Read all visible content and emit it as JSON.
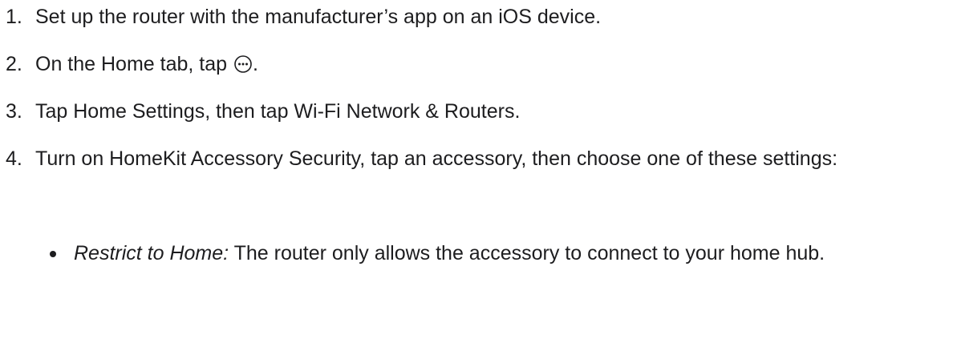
{
  "steps": [
    {
      "number": "1.",
      "text": "Set up the router with the manufacturer’s app on an iOS device."
    },
    {
      "number": "2.",
      "text_before": "On the Home tab, tap",
      "icon": "more-ellipsis-circle-icon",
      "text_after": "."
    },
    {
      "number": "3.",
      "text": "Tap Home Settings, then tap Wi-Fi Network & Routers."
    },
    {
      "number": "4.",
      "text": "Turn on HomeKit Accessory Security, tap an accessory, then choose one of these settings:"
    }
  ],
  "options": [
    {
      "term": "Restrict to Home:",
      "description": "The router only allows the accessory to connect to your home hub."
    }
  ]
}
